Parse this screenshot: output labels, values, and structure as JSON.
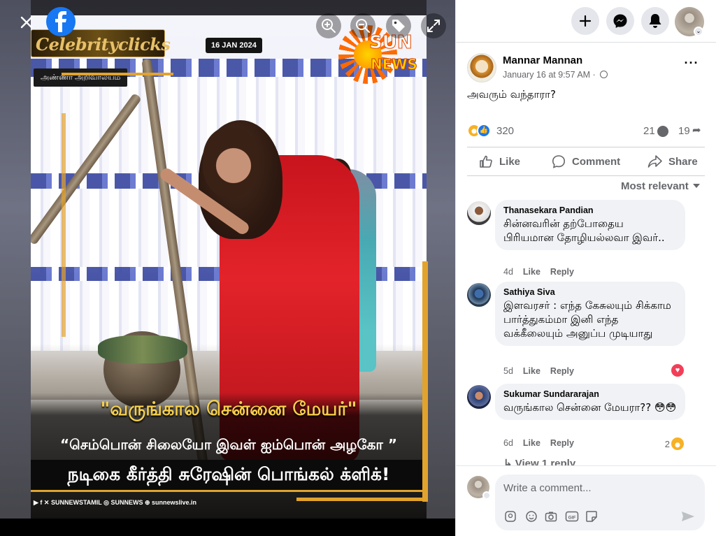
{
  "viewer": {
    "poster": {
      "brand_text": "Celebrityclicks",
      "date_badge": "16 JAN 2024",
      "location_badge": "அண்ணா அறிவாலயம்",
      "channel_word1": "SUN",
      "channel_word2": "NEWS",
      "tag_line": "\"வருங்கால சென்னை மேயர்\"",
      "quote_line": "“செம்பொன் சிலையோ இவள் ஐம்பொன் அழகோ ”",
      "headline": "நடிகை கீர்த்தி சுரேஷின் பொங்கல் க்ளிக்!",
      "social_handles": "▶ f ✕ SUNNEWSTAMIL  ◎ SUNNEWS  ⊕ sunnewslive.in"
    },
    "controls": [
      "close-icon",
      "facebook-logo",
      "zoom-in-icon",
      "zoom-out-icon",
      "tag-icon",
      "fullscreen-icon"
    ]
  },
  "topbar": {
    "icons": [
      "plus-icon",
      "messenger-icon",
      "bell-icon",
      "profile-avatar"
    ]
  },
  "post": {
    "author": "Mannar Mannan",
    "timestamp": "January 16 at 9:57 AM · ",
    "text": "அவரும் வந்தாரா?",
    "reaction_count": "320",
    "comment_count": "21",
    "share_count": "19",
    "actions": {
      "like": "Like",
      "comment": "Comment",
      "share": "Share"
    }
  },
  "sort_label": "Most relevant",
  "comments": [
    {
      "name": "Thanasekara Pandian",
      "text": "சின்னவரின் தற்போதைய பிரியமான தோழியல்லவா இவர்..",
      "age": "4d",
      "like": "Like",
      "reply": "Reply"
    },
    {
      "name": "Sathiya Siva",
      "text": "இளவரசர் : எந்த கேசுலயும் சிக்காம பார்த்துகம்மா இனி எந்த வக்கீலையும் அனுப்ப முடியாது",
      "age": "5d",
      "like": "Like",
      "reply": "Reply"
    },
    {
      "name": "Sukumar Sundararajan",
      "text": "வருங்கால சென்னை மேயரா?? 😳😳",
      "age": "6d",
      "like": "Like",
      "reply": "Reply",
      "reaction_count": "2"
    }
  ],
  "view_reply": "↳ View 1 reply",
  "composer": {
    "placeholder": "Write a comment..."
  },
  "colors": {
    "facebook_blue": "#1877f2",
    "secondary_text": "#65676b",
    "bubble_bg": "#f0f2f5"
  }
}
